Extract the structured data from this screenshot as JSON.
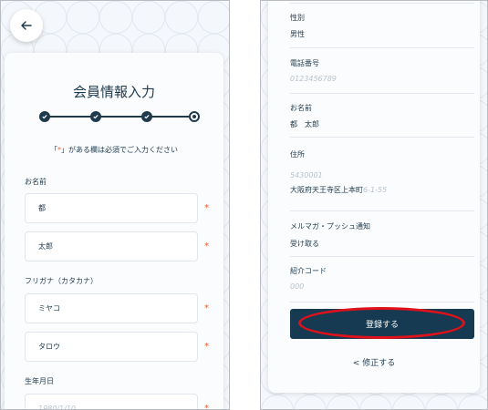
{
  "left": {
    "title": "会員情報入力",
    "required_note": {
      "prefix": "「",
      "star": "*",
      "suffix": "」がある欄は必須でご入力ください"
    },
    "name_label": "お名前",
    "last_name": "都",
    "first_name": "太郎",
    "kana_label": "フリガナ（カタカナ）",
    "last_kana": "ミヤコ",
    "first_kana": "タロウ",
    "birth_label": "生年月日",
    "birth_placeholder": "1980/1/10",
    "star": "*"
  },
  "right": {
    "gender_label": "性別",
    "gender_value": "男性",
    "phone_label": "電話番号",
    "phone_placeholder": "0123456789",
    "name_label": "お名前",
    "name_value": "都　太郎",
    "address_label": "住所",
    "postal_placeholder": "5430001",
    "address_value": "大阪府天王寺区上本町",
    "address_placeholder": "6-1-55",
    "newsletter_label": "メルマガ・プッシュ通知",
    "newsletter_value": "受け取る",
    "referral_label": "紹介コード",
    "referral_placeholder": "000",
    "register_button": "登録する",
    "back_link": "修正する",
    "back_chevron": "<"
  },
  "colors": {
    "primary": "#163a52",
    "required": "#e8622c",
    "highlight": "#e0111b"
  },
  "icons": [
    "arrow-left-icon",
    "check-icon",
    "chevron-left-icon"
  ]
}
